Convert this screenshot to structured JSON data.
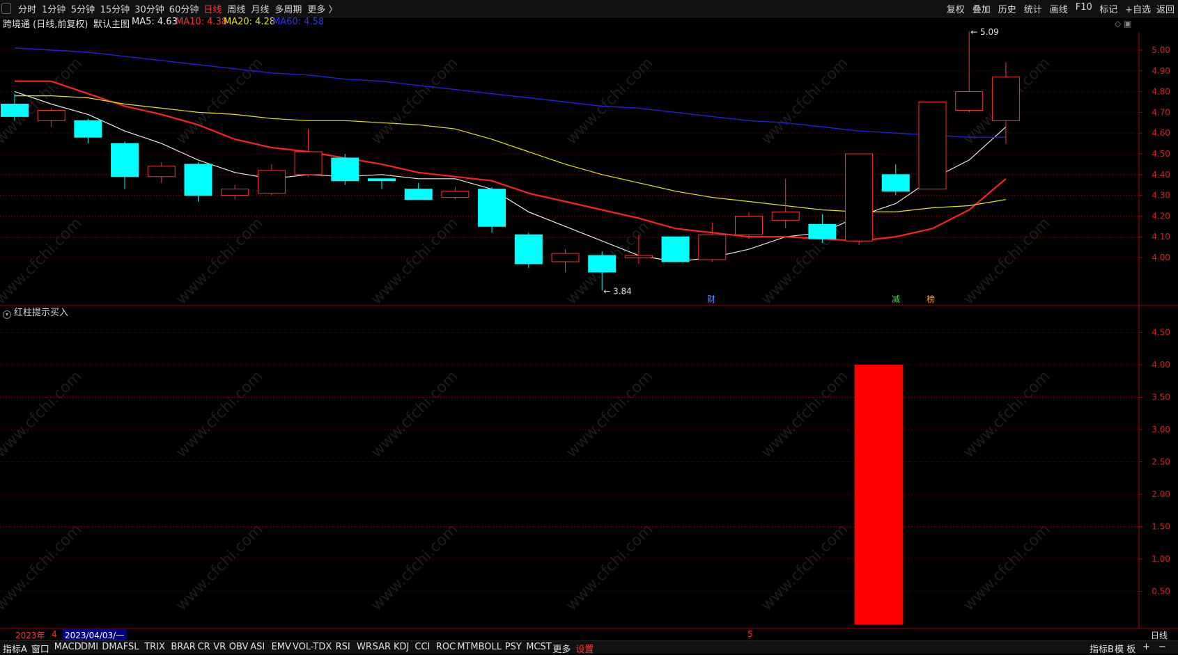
{
  "top_toolbar": {
    "periods": [
      "分时",
      "1分钟",
      "5分钟",
      "15分钟",
      "30分钟",
      "60分钟",
      "日线",
      "周线",
      "月线",
      "多周期",
      "更多 〉"
    ],
    "active_period": "日线",
    "right_buttons": [
      "复权",
      "叠加",
      "历史",
      "统计",
      "画线",
      "F10",
      "标记",
      "+自选",
      "返回"
    ]
  },
  "info_bar": {
    "stock": "跨境通 (日线,前复权)",
    "main_chart": "默认主图",
    "ma5": "MA5: 4.63",
    "ma10": "MA10: 4.38",
    "ma20": "MA20: 4.28",
    "ma60": "MA60: 4.58"
  },
  "colors": {
    "up": "#ff3030",
    "down": "#00ffff",
    "ma5": "#e8e8e8",
    "ma10": "#ff2020",
    "ma20": "#e6e600",
    "ma60": "#2020e0",
    "grid": "#7a0000",
    "axis_text": "#cc2222"
  },
  "chart_data": [
    {
      "type": "candlestick",
      "title": "跨境通 (日线,前复权)",
      "ylim": [
        3.82,
        5.16
      ],
      "yticks": [
        "5.00",
        "4.90",
        "4.80",
        "4.70",
        "4.60",
        "4.50",
        "4.40",
        "4.30",
        "4.20",
        "4.10",
        "4.00"
      ],
      "candles": [
        {
          "o": 4.74,
          "c": 4.68,
          "h": 4.79,
          "l": 4.66
        },
        {
          "o": 4.66,
          "c": 4.71,
          "h": 4.72,
          "l": 4.63
        },
        {
          "o": 4.66,
          "c": 4.58,
          "h": 4.67,
          "l": 4.55
        },
        {
          "o": 4.55,
          "c": 4.39,
          "h": 4.56,
          "l": 4.33
        },
        {
          "o": 4.39,
          "c": 4.44,
          "h": 4.46,
          "l": 4.36
        },
        {
          "o": 4.45,
          "c": 4.3,
          "h": 4.46,
          "l": 4.27
        },
        {
          "o": 4.3,
          "c": 4.33,
          "h": 4.35,
          "l": 4.28
        },
        {
          "o": 4.31,
          "c": 4.42,
          "h": 4.45,
          "l": 4.3
        },
        {
          "o": 4.4,
          "c": 4.51,
          "h": 4.62,
          "l": 4.39
        },
        {
          "o": 4.48,
          "c": 4.37,
          "h": 4.5,
          "l": 4.35
        },
        {
          "o": 4.38,
          "c": 4.37,
          "h": 4.38,
          "l": 4.33
        },
        {
          "o": 4.33,
          "c": 4.28,
          "h": 4.36,
          "l": 4.28
        },
        {
          "o": 4.29,
          "c": 4.32,
          "h": 4.34,
          "l": 4.28
        },
        {
          "o": 4.33,
          "c": 4.15,
          "h": 4.34,
          "l": 4.12
        },
        {
          "o": 4.11,
          "c": 3.97,
          "h": 4.12,
          "l": 3.95
        },
        {
          "o": 3.98,
          "c": 4.02,
          "h": 4.04,
          "l": 3.93
        },
        {
          "o": 4.01,
          "c": 3.93,
          "h": 4.03,
          "l": 3.84
        },
        {
          "o": 4.0,
          "c": 4.01,
          "h": 4.11,
          "l": 3.97
        },
        {
          "o": 4.1,
          "c": 3.98,
          "h": 4.1,
          "l": 3.98
        },
        {
          "o": 3.99,
          "c": 4.11,
          "h": 4.17,
          "l": 3.98
        },
        {
          "o": 4.11,
          "c": 4.2,
          "h": 4.22,
          "l": 4.09
        },
        {
          "o": 4.18,
          "c": 4.22,
          "h": 4.38,
          "l": 4.14
        },
        {
          "o": 4.16,
          "c": 4.09,
          "h": 4.21,
          "l": 4.07
        },
        {
          "o": 4.08,
          "c": 4.5,
          "h": 4.5,
          "l": 4.06
        },
        {
          "o": 4.4,
          "c": 4.32,
          "h": 4.45,
          "l": 4.3
        },
        {
          "o": 4.33,
          "c": 4.75,
          "h": 4.75,
          "l": 4.33
        },
        {
          "o": 4.71,
          "c": 4.8,
          "h": 5.09,
          "l": 4.7
        },
        {
          "o": 4.66,
          "c": 4.87,
          "h": 4.94,
          "l": 4.55
        }
      ],
      "ma": {
        "MA5": [
          4.8,
          4.74,
          4.69,
          4.61,
          4.55,
          4.47,
          4.41,
          4.38,
          4.4,
          4.39,
          4.4,
          4.38,
          4.38,
          4.33,
          4.22,
          4.15,
          4.08,
          4.01,
          3.98,
          4.0,
          4.04,
          4.1,
          4.12,
          4.2,
          4.26,
          4.38,
          4.47,
          4.63
        ],
        "MA10": [
          4.85,
          4.85,
          4.79,
          4.73,
          4.69,
          4.64,
          4.57,
          4.53,
          4.51,
          4.48,
          4.45,
          4.41,
          4.39,
          4.37,
          4.31,
          4.27,
          4.23,
          4.19,
          4.14,
          4.12,
          4.1,
          4.1,
          4.09,
          4.08,
          4.1,
          4.14,
          4.23,
          4.38
        ],
        "MA20": [
          4.78,
          4.78,
          4.77,
          4.74,
          4.72,
          4.7,
          4.69,
          4.67,
          4.66,
          4.66,
          4.65,
          4.64,
          4.62,
          4.57,
          4.51,
          4.45,
          4.4,
          4.36,
          4.32,
          4.29,
          4.27,
          4.25,
          4.23,
          4.22,
          4.22,
          4.24,
          4.25,
          4.28
        ],
        "MA60": [
          5.01,
          5.0,
          4.99,
          4.97,
          4.95,
          4.93,
          4.91,
          4.89,
          4.88,
          4.86,
          4.85,
          4.83,
          4.81,
          4.79,
          4.77,
          4.75,
          4.73,
          4.72,
          4.7,
          4.68,
          4.66,
          4.65,
          4.63,
          4.61,
          4.6,
          4.59,
          4.58,
          4.58
        ]
      },
      "labels": {
        "high": "5.09",
        "low": "3.84"
      },
      "markers": [
        "财",
        "减",
        "榜"
      ]
    },
    {
      "type": "bar",
      "title": "红柱提示买入",
      "ylim": [
        0,
        5.0
      ],
      "yticks": [
        "4.50",
        "4.00",
        "3.50",
        "3.00",
        "2.50",
        "2.00",
        "1.50",
        "1.00",
        "0.50"
      ],
      "bars": [
        {
          "from_candle": 23,
          "to_candle": 24,
          "value": 4.0
        }
      ]
    }
  ],
  "date_bar": {
    "year": "2023年",
    "month": "4",
    "date": "2023/04/03/一",
    "month_mark": "5",
    "period": "日线"
  },
  "bottom_toolbar": {
    "items": [
      "指标A",
      "窗口",
      "MACD",
      "DMI",
      "DMA",
      "FSL",
      "TRIX",
      "BRAR",
      "CR",
      "VR",
      "OBV",
      "ASI",
      "EMV",
      "VOL-TDX",
      "RSI",
      "WR",
      "SAR",
      "KDJ",
      "CCI",
      "ROC",
      "MTM",
      "BOLL",
      "PSY",
      "MCST",
      "更多",
      "设置"
    ],
    "active": "设置",
    "right_items": [
      "指标B",
      "模 板",
      "+",
      "−"
    ]
  },
  "watermark": "www.cfchi.com"
}
